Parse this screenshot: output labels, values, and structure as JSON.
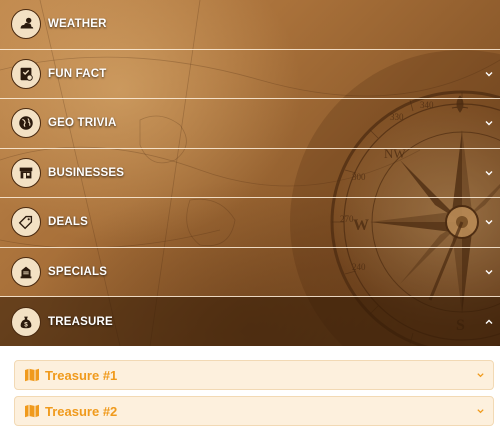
{
  "colors": {
    "accent": "#f09a1c",
    "sub_item_bg": "#fdf0dd",
    "row_text": "#ffffff"
  },
  "accordion": {
    "items": [
      {
        "label": "WEATHER",
        "icon": "weather-icon",
        "open": false
      },
      {
        "label": "FUN FACT",
        "icon": "checklist-icon",
        "open": false
      },
      {
        "label": "GEO TRIVIA",
        "icon": "globe-icon",
        "open": false
      },
      {
        "label": "BUSINESSES",
        "icon": "storefront-icon",
        "open": false
      },
      {
        "label": "DEALS",
        "icon": "tag-icon",
        "open": false
      },
      {
        "label": "SPECIALS",
        "icon": "specials-icon",
        "open": false
      },
      {
        "label": "TREASURE",
        "icon": "money-bag-icon",
        "open": true
      }
    ]
  },
  "treasure_panel": {
    "items": [
      {
        "label": "Treasure #1",
        "icon": "map-icon"
      },
      {
        "label": "Treasure #2",
        "icon": "map-icon"
      }
    ]
  },
  "compass": {
    "markings": [
      "NW",
      "W",
      "S",
      "340",
      "330",
      "300",
      "270",
      "240"
    ]
  }
}
